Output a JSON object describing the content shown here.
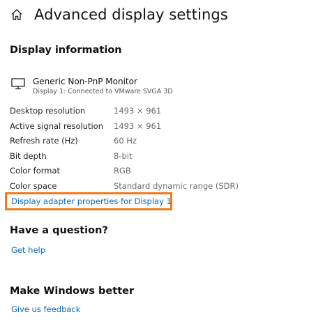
{
  "header": {
    "icon": "home-icon",
    "title": "Advanced display settings"
  },
  "display_info": {
    "heading": "Display information",
    "monitor": {
      "icon": "monitor-icon",
      "name": "Generic Non-PnP Monitor",
      "subtitle": "Display 1: Connected to VMware SVGA 3D"
    },
    "rows": [
      {
        "label": "Desktop resolution",
        "value": "1493 × 961"
      },
      {
        "label": "Active signal resolution",
        "value": "1493 × 961"
      },
      {
        "label": "Refresh rate (Hz)",
        "value": "60 Hz"
      },
      {
        "label": "Bit depth",
        "value": "8-bit"
      },
      {
        "label": "Color format",
        "value": "RGB"
      },
      {
        "label": "Color space",
        "value": "Standard dynamic range (SDR)"
      }
    ],
    "adapter_link": "Display adapter properties for Display 1"
  },
  "question": {
    "heading": "Have a question?",
    "link": "Get help"
  },
  "feedback": {
    "heading": "Make Windows better",
    "link": "Give us feedback"
  },
  "colors": {
    "link": "#0b6ab8",
    "highlight": "#f27a1a"
  }
}
